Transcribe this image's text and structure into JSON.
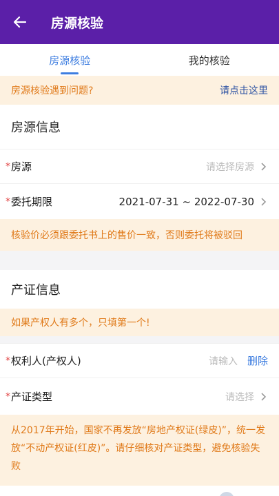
{
  "header": {
    "title": "房源核验"
  },
  "tabs": [
    {
      "label": "房源核验",
      "active": true
    },
    {
      "label": "我的核验",
      "active": false
    }
  ],
  "help_banner": {
    "text": "房源核验遇到问题?",
    "link": "请点击这里"
  },
  "house_section": {
    "title": "房源信息",
    "fields": [
      {
        "label": "房源",
        "required": true,
        "value": "请选择房源"
      },
      {
        "label": "委托期限",
        "required": true,
        "value": "2021-07-31 ~ 2022-07-30"
      }
    ],
    "note": "核验价必须跟委托书上的售价一致，否则委托将被驳回"
  },
  "cert_section": {
    "title": "产证信息",
    "note": "如果产权人有多个，只填第一个!",
    "fields": [
      {
        "label": "权利人(产权人)",
        "required": true,
        "placeholder": "请输入",
        "action": "删除"
      },
      {
        "label": "产证类型",
        "required": true,
        "value": "请选择"
      }
    ],
    "notice": "从2017年开始，国家不再发放“房地产权证(绿皮)”，统一发放“不动产权证(红皮)”。请仔细核对产证类型，避免核验失败"
  },
  "colors": {
    "brand": "#5b1fa8",
    "accent": "#3d7de0",
    "warning": "#e07a1a",
    "required": "#e03a3a"
  }
}
